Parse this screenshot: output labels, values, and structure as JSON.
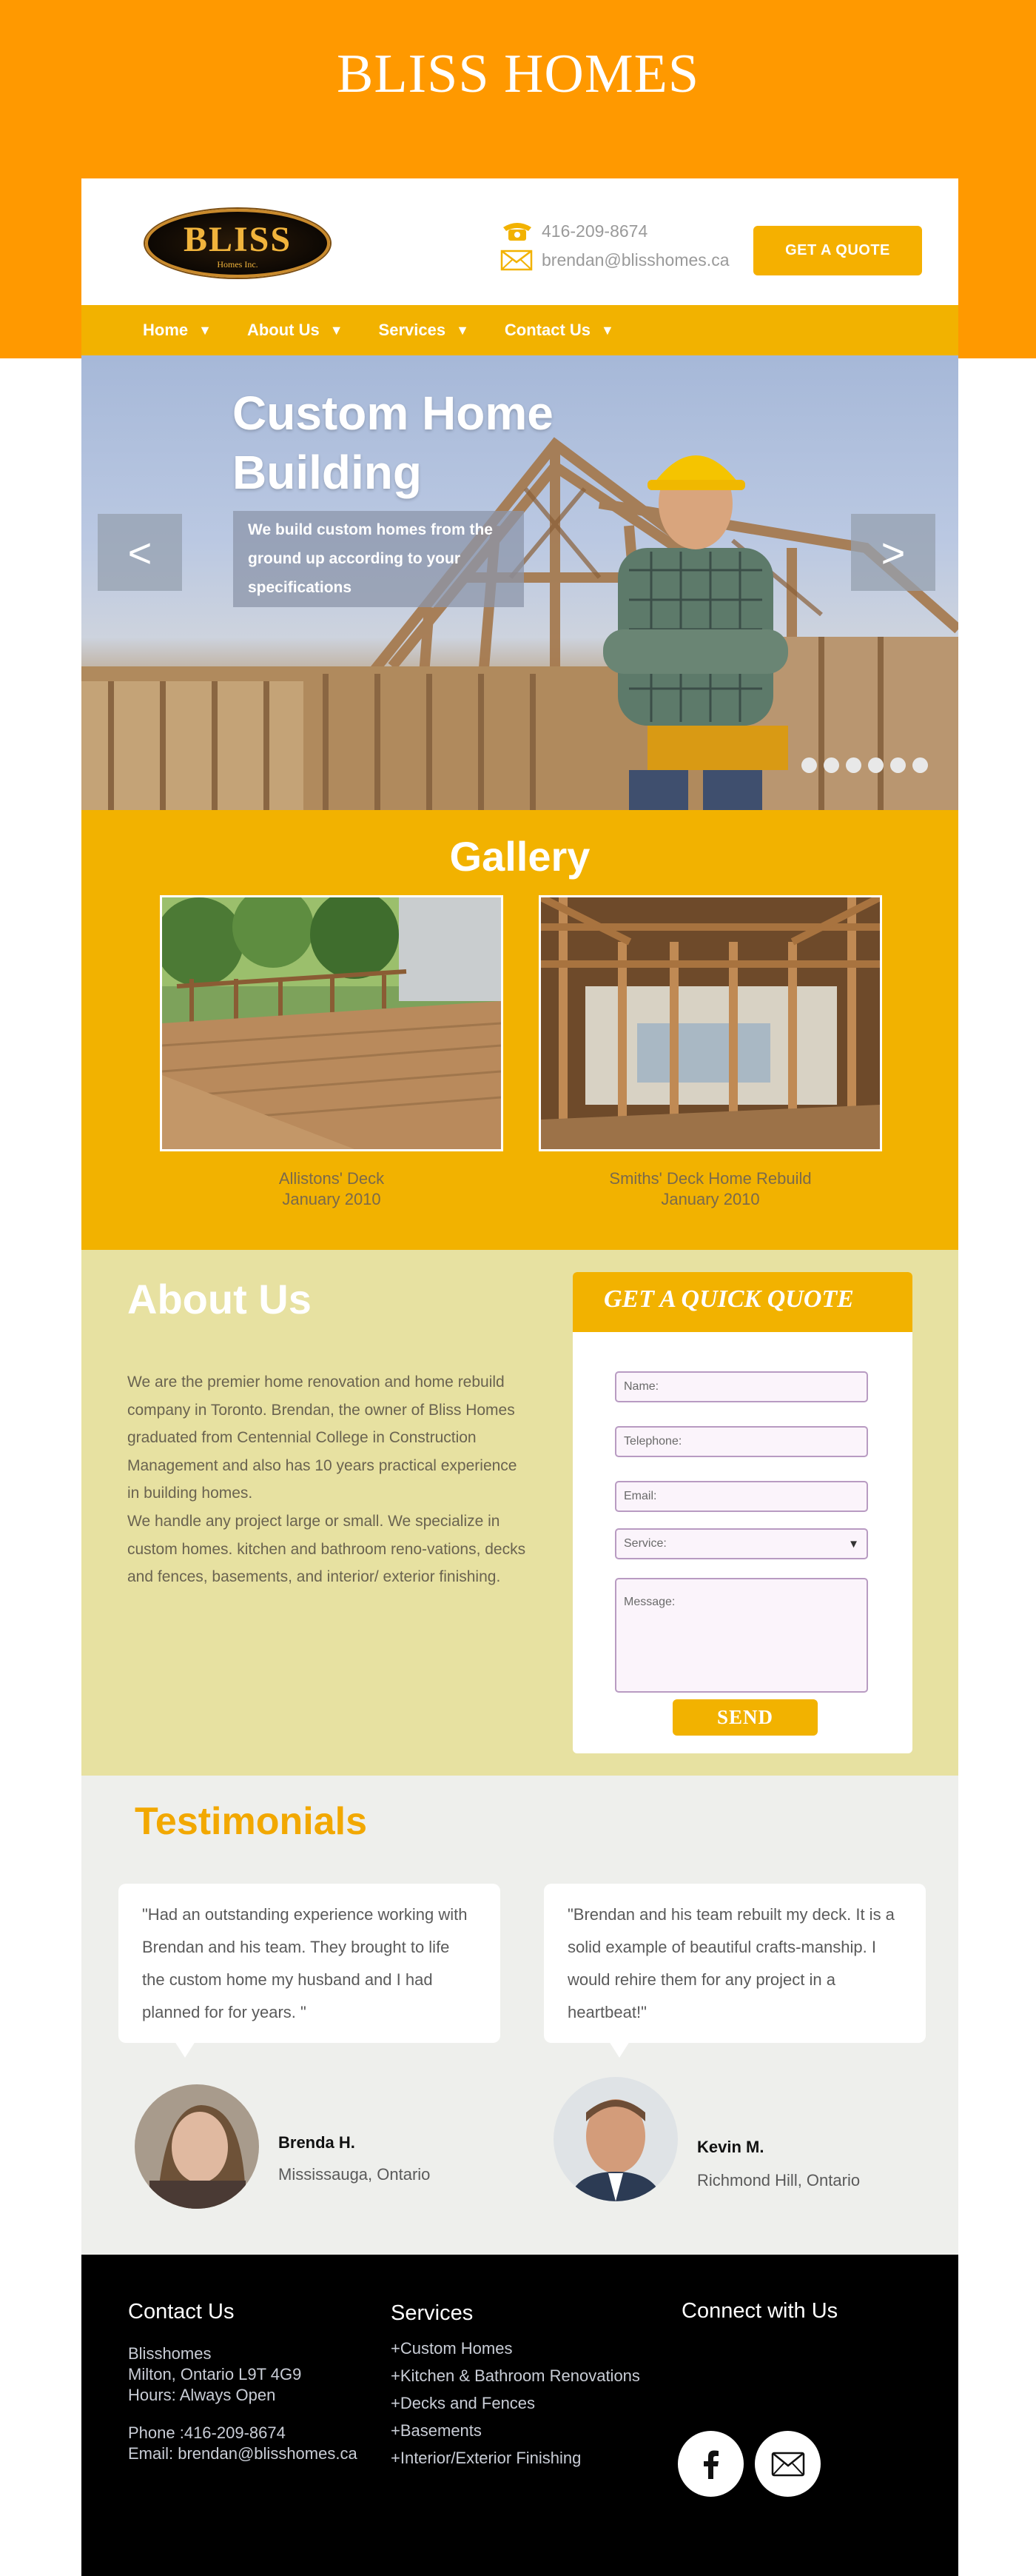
{
  "site": {
    "title": "BLISS HOMES"
  },
  "header": {
    "logo_text": "BLISS",
    "logo_sub": "Homes Inc.",
    "phone": "416-209-8674",
    "email": "brendan@blisshomes.ca",
    "quote_button": "GET A QUOTE",
    "icons": {
      "phone": "phone-icon",
      "email": "envelope-icon"
    }
  },
  "nav": {
    "items": [
      {
        "label": "Home",
        "caret": "▼"
      },
      {
        "label": "About Us",
        "caret": "▼"
      },
      {
        "label": "Services",
        "caret": "▼"
      },
      {
        "label": "Contact Us",
        "caret": "▼"
      }
    ]
  },
  "hero": {
    "title": "Custom Home Building",
    "subtitle": "We build custom homes from the ground up according to your specifications",
    "prev": "<",
    "next": ">",
    "slide_count": 6
  },
  "gallery": {
    "title": "Gallery",
    "items": [
      {
        "caption_line1": "Allistons' Deck",
        "caption_line2": "January 2010"
      },
      {
        "caption_line1": "Smiths' Deck  Home Rebuild",
        "caption_line2": "January 2010"
      }
    ]
  },
  "about": {
    "title": "About Us",
    "p1": "We are the premier home renovation and home rebuild company in Toronto.  Brendan, the owner of Bliss Homes graduated from Centennial College in Construction Management and also has 10 years practical experience in building homes.",
    "p2": "We handle any project large or small. We specialize in custom homes. kitchen and bathroom reno-vations, decks and fences, basements, and interior/ exterior finishing."
  },
  "quote_form": {
    "title": "GET A QUICK QUOTE",
    "name_placeholder": "Name:",
    "telephone_placeholder": "Telephone:",
    "email_placeholder": "Email:",
    "service_placeholder": "Service:",
    "message_placeholder": "Message:",
    "select_caret": "▼",
    "send": "SEND"
  },
  "testimonials": {
    "title": "Testimonials",
    "items": [
      {
        "quote": "\"Had an outstanding experience working with Brendan and his team. They brought to life the custom home my husband and I had planned for for years. \"",
        "name": "Brenda H.",
        "location": "Mississauga, Ontario"
      },
      {
        "quote": "\"Brendan and his team rebuilt my deck. It is a solid example of beautiful crafts-manship.  I would rehire them for any project in a heartbeat!\"",
        "name": "Kevin M.",
        "location": "Richmond Hill, Ontario"
      }
    ]
  },
  "footer": {
    "contact_title": "Contact Us",
    "company": "Blisshomes",
    "address": "Milton, Ontario L9T 4G9",
    "hours": "Hours: Always Open",
    "phone": "Phone :416-209-8674",
    "email": "Email: brendan@blisshomes.ca",
    "services_title": "Services",
    "services": [
      "+Custom Homes",
      "+Kitchen & Bathroom Renovations",
      "+Decks and Fences",
      "+Basements",
      "+Interior/Exterior Finishing"
    ],
    "connect_title": "Connect with Us",
    "social_icons": [
      "facebook-icon",
      "envelope-icon"
    ]
  },
  "colors": {
    "orange": "#ff9900",
    "gold": "#f2b200",
    "about_bg": "#e7e1a1",
    "testimonials_bg": "#eeefec",
    "footer_bg": "#000000"
  }
}
